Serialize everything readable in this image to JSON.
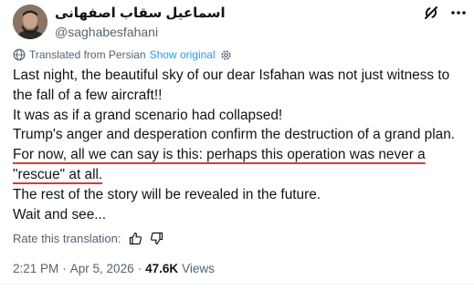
{
  "author": {
    "display_name": "اسماعیل سقاب اصفهانی",
    "handle": "@saghabesfahani"
  },
  "translation": {
    "label": "Translated from Persian",
    "show_original": "Show original"
  },
  "tweet": {
    "lines": {
      "l1": "Last night, the beautiful sky of our dear Isfahan was not just witness to",
      "l2": "the fall of a few aircraft!!",
      "l3": "It was as if a grand scenario had collapsed!",
      "l4": "Trump's anger and desperation confirm the destruction of a grand plan.",
      "l5": "For now, all we can say is this: perhaps this operation was never a",
      "l6": "\"rescue\" at all.",
      "l7": "The rest of the story will be revealed in the future.",
      "l8": "Wait and see..."
    }
  },
  "rating": {
    "label": "Rate this translation:"
  },
  "meta": {
    "time": "2:21 PM",
    "separator": "·",
    "date": "Apr 5, 2026",
    "views_count": "47.6K",
    "views_label": "Views"
  },
  "icons": {
    "globe": "globe-icon",
    "gear": "gear-icon",
    "grok": "grok-icon",
    "more": "more-icon",
    "thumbs_up": "thumbs-up-icon",
    "thumbs_down": "thumbs-down-icon"
  },
  "colors": {
    "text": "#0f1419",
    "secondary": "#536471",
    "link": "#1d9bf0",
    "highlight_underline": "#d93a3a"
  }
}
